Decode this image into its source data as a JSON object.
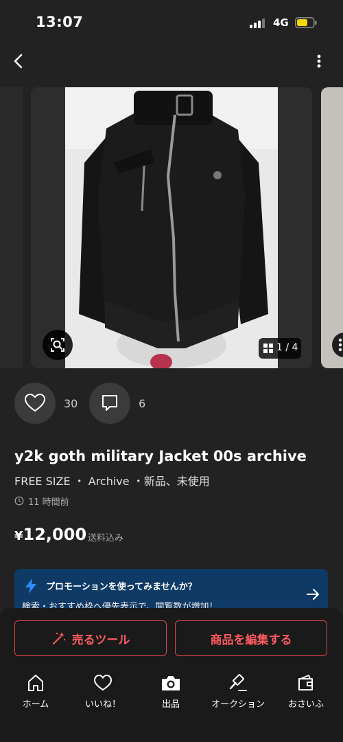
{
  "status_bar": {
    "time": "13:07",
    "network": "4G"
  },
  "carousel": {
    "counter": "1 / 4"
  },
  "engagement": {
    "likes": "30",
    "comments": "6"
  },
  "item": {
    "title": "y2k goth military Jacket 00s archive",
    "meta": "FREE SIZE ・ Archive ・新品、未使用",
    "posted": "11 時間前",
    "price_symbol": "¥",
    "price": "12,000",
    "shipping": "送料込み"
  },
  "promo": {
    "title": "プロモーションを使ってみませんか？",
    "body": "検索・おすすめ枠へ優先表示で、閲覧数が増加！"
  },
  "actions": {
    "tools": "売るツール",
    "edit": "商品を編集する"
  },
  "tabs": [
    {
      "label": "ホーム",
      "icon": "home-icon"
    },
    {
      "label": "いいね！",
      "icon": "heart-icon"
    },
    {
      "label": "出品",
      "icon": "camera-icon"
    },
    {
      "label": "オークション",
      "icon": "gavel-icon"
    },
    {
      "label": "おさいふ",
      "icon": "wallet-icon"
    }
  ],
  "colors": {
    "background": "#222222",
    "accent": "#ff5a5f",
    "promo": "#0f3a66",
    "promo_icon": "#2d8cff",
    "battery": "#f5d90a"
  }
}
